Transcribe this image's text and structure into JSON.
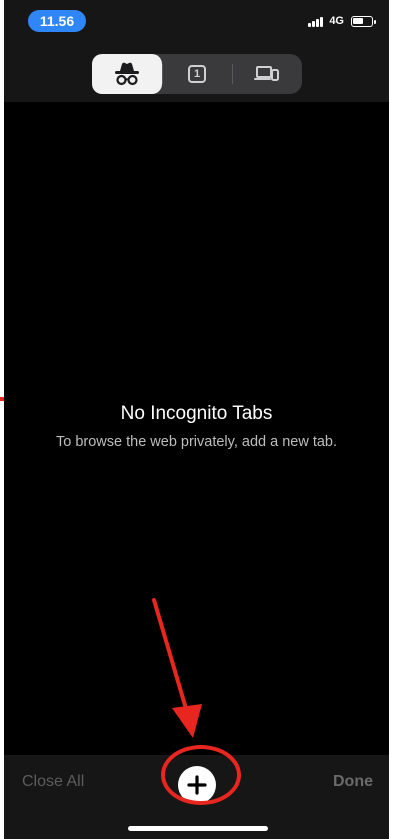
{
  "status_bar": {
    "time": "11.56",
    "network": "4G",
    "battery_level": 0.65
  },
  "tab_switcher": {
    "segments": [
      {
        "icon": "incognito-icon",
        "active": true
      },
      {
        "icon": "tab-count-icon",
        "count": "1",
        "active": false
      },
      {
        "icon": "devices-icon",
        "active": false
      }
    ]
  },
  "empty_state": {
    "title": "No Incognito Tabs",
    "subtitle": "To browse the web privately, add a new tab."
  },
  "toolbar": {
    "close_all_label": "Close All",
    "done_label": "Done",
    "new_tab_icon": "plus-icon"
  },
  "colors": {
    "accent_blue": "#2f86f6",
    "annotation_red": "#e8261f",
    "toolbar_bg": "#161616",
    "content_bg": "#000000"
  }
}
